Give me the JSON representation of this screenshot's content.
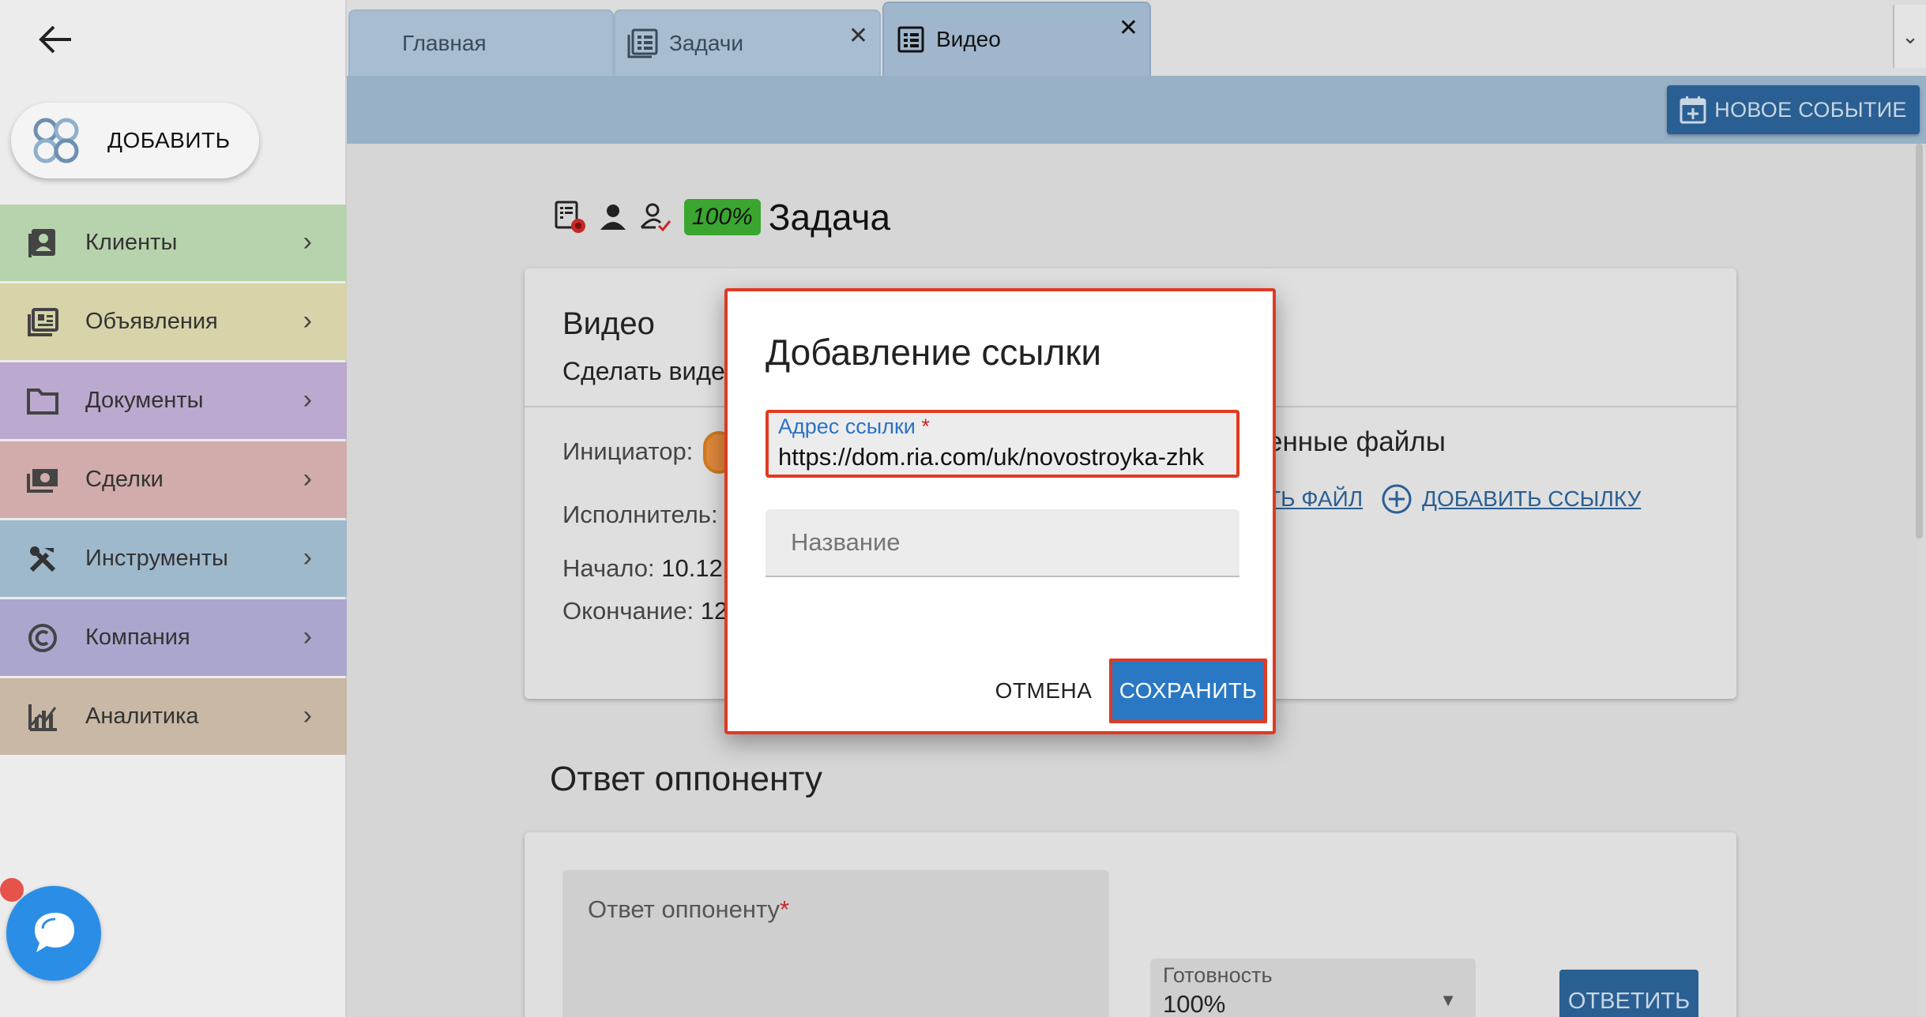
{
  "sidebar": {
    "add_label": "ДОБАВИТЬ",
    "items": [
      {
        "label": "Клиенты",
        "icon": "contacts-icon",
        "color": "#b7d3ad"
      },
      {
        "label": "Объявления",
        "icon": "listings-icon",
        "color": "#d6d4a8"
      },
      {
        "label": "Документы",
        "icon": "folder-icon",
        "color": "#bba9cf"
      },
      {
        "label": "Сделки",
        "icon": "money-icon",
        "color": "#d2abab"
      },
      {
        "label": "Инструменты",
        "icon": "tools-icon",
        "color": "#9fb9cc"
      },
      {
        "label": "Компания",
        "icon": "copyright-icon",
        "color": "#aaa6cd"
      },
      {
        "label": "Аналитика",
        "icon": "analytics-icon",
        "color": "#c9b8a5"
      }
    ]
  },
  "tabs": [
    {
      "label": "Главная",
      "closable": false
    },
    {
      "label": "Задачи",
      "closable": true
    },
    {
      "label": "Видео",
      "closable": true,
      "active": true
    }
  ],
  "toolbar": {
    "new_event_label": "НОВОЕ СОБЫТИЕ"
  },
  "task": {
    "progress_badge": "100%",
    "title": "Задача",
    "card_title": "Видео",
    "card_subtitle": "Сделать виде",
    "initiator_label": "Инициатор:",
    "executor_label": "Исполнитель:",
    "start_label": "Начало:",
    "start_value": "10.12",
    "end_label": "Окончание:",
    "end_value": "12",
    "files_heading": "енные файлы",
    "upload_link": "ТЬ ФАЙЛ",
    "add_link": "ДОБАВИТЬ ССЫЛКУ"
  },
  "reply": {
    "section_title": "Ответ оппоненту",
    "field_label": "Ответ оппоненту",
    "readiness_label": "Готовность",
    "readiness_value": "100%",
    "answer_button": "ОТВЕТИТЬ"
  },
  "dialog": {
    "title": "Добавление ссылки",
    "url_label": "Адрес ссылки",
    "url_value": "https://dom.ria.com/uk/novostroyka-zhk",
    "name_placeholder": "Название",
    "cancel_label": "ОТМЕНА",
    "save_label": "СОХРАНИТЬ"
  },
  "colors": {
    "accent": "#2a5f93",
    "highlight": "#e03a22",
    "badge": "#3aa52f"
  }
}
